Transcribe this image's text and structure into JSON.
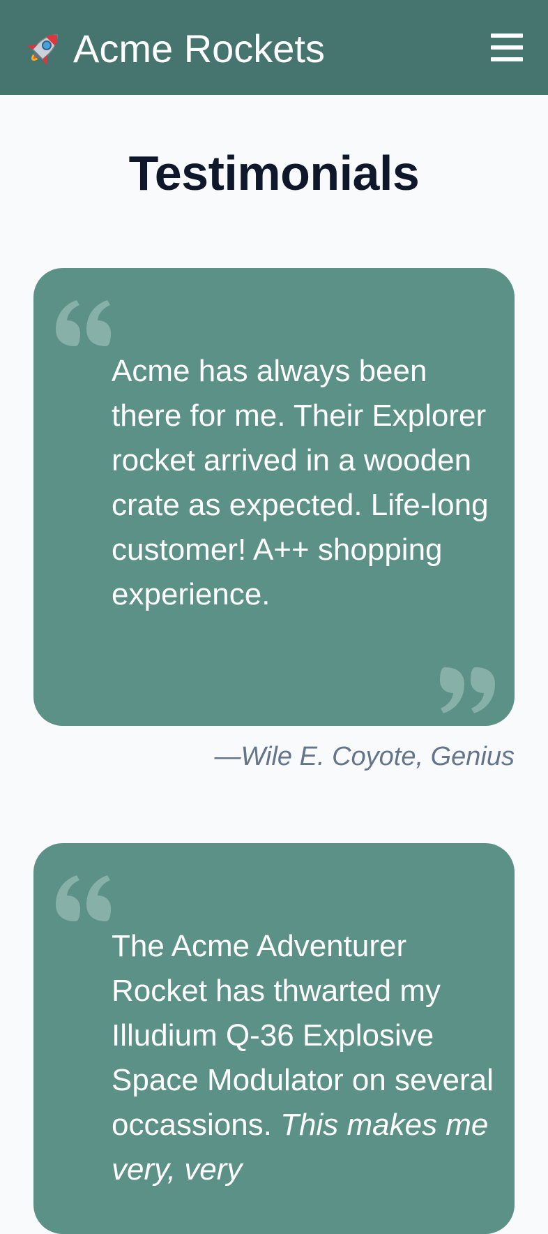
{
  "header": {
    "brand": "Acme Rockets",
    "logo_icon": "rocket-icon",
    "menu_icon": "hamburger-menu-icon",
    "background": "#46746f"
  },
  "page": {
    "title": "Testimonials"
  },
  "testimonials": [
    {
      "quote": "Acme has always been there for me. Their Explorer rocket arrived in a wooden crate as expected. Life-long customer! A++ shopping experience.",
      "attribution": "—Wile E. Coyote, Genius"
    },
    {
      "quote_start": "The Acme Adventurer Rocket has thwarted my Illudium Q-36 Explosive Space Modulator on several occassions. ",
      "quote_emphasis": "This makes me very, very"
    }
  ],
  "colors": {
    "card": "#5b9187",
    "quote_mark": "#86b0a8",
    "title": "#0f172a",
    "attribution": "#64748b",
    "page_background": "#f8fafc"
  }
}
